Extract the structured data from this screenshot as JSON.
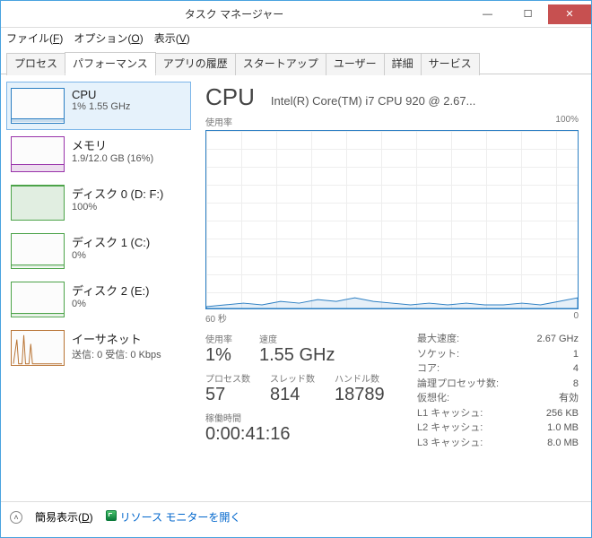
{
  "window": {
    "title": "タスク マネージャー"
  },
  "menu": {
    "file": "ファイル(<u>F</u>)",
    "options": "オプション(<u>O</u>)",
    "view": "表示(<u>V</u>)"
  },
  "tabs": [
    "プロセス",
    "パフォーマンス",
    "アプリの履歴",
    "スタートアップ",
    "ユーザー",
    "詳細",
    "サービス"
  ],
  "active_tab": 1,
  "sidebar": [
    {
      "name": "cpu",
      "title": "CPU",
      "sub": "1% 1.55 GHz",
      "selected": true
    },
    {
      "name": "mem",
      "title": "メモリ",
      "sub": "1.9/12.0 GB (16%)"
    },
    {
      "name": "d0",
      "title": "ディスク 0 (D: F:)",
      "sub": "100%"
    },
    {
      "name": "d1",
      "title": "ディスク 1 (C:)",
      "sub": "0%"
    },
    {
      "name": "d2",
      "title": "ディスク 2 (E:)",
      "sub": "0%"
    },
    {
      "name": "eth",
      "title": "イーサネット",
      "sub": "送信: 0 受信: 0 Kbps"
    }
  ],
  "main": {
    "heading": "CPU",
    "model": "Intel(R) Core(TM) i7 CPU 920 @ 2.67...",
    "chart_ylabel": "使用率",
    "chart_ymax": "100%",
    "chart_xleft": "60 秒",
    "chart_xright": "0",
    "bigstats": [
      {
        "lbl": "使用率",
        "val": "1%"
      },
      {
        "lbl": "速度",
        "val": "1.55 GHz"
      }
    ],
    "bigstats2": [
      {
        "lbl": "プロセス数",
        "val": "57"
      },
      {
        "lbl": "スレッド数",
        "val": "814"
      },
      {
        "lbl": "ハンドル数",
        "val": "18789"
      }
    ],
    "uptime_lbl": "稼働時間",
    "uptime": "0:00:41:16",
    "right": [
      {
        "k": "最大速度:",
        "v": "2.67 GHz"
      },
      {
        "k": "ソケット:",
        "v": "1"
      },
      {
        "k": "コア:",
        "v": "4"
      },
      {
        "k": "論理プロセッサ数:",
        "v": "8"
      },
      {
        "k": "仮想化:",
        "v": "有効"
      },
      {
        "k": "L1 キャッシュ:",
        "v": "256 KB"
      },
      {
        "k": "L2 キャッシュ:",
        "v": "1.0 MB"
      },
      {
        "k": "L3 キャッシュ:",
        "v": "8.0 MB"
      }
    ]
  },
  "footer": {
    "fewer": "簡易表示(<u>D</u>)",
    "resmon": "リソース モニターを開く"
  },
  "chart_data": {
    "type": "line",
    "title": "CPU 使用率",
    "xlabel": "秒",
    "ylabel": "%",
    "xlim": [
      0,
      60
    ],
    "ylim": [
      0,
      100
    ],
    "x": [
      60,
      57,
      54,
      51,
      48,
      45,
      42,
      39,
      36,
      33,
      30,
      27,
      24,
      21,
      18,
      15,
      12,
      9,
      6,
      3,
      0
    ],
    "values": [
      1,
      2,
      3,
      2,
      4,
      3,
      5,
      4,
      6,
      4,
      3,
      2,
      3,
      2,
      3,
      2,
      2,
      3,
      2,
      4,
      6
    ]
  }
}
